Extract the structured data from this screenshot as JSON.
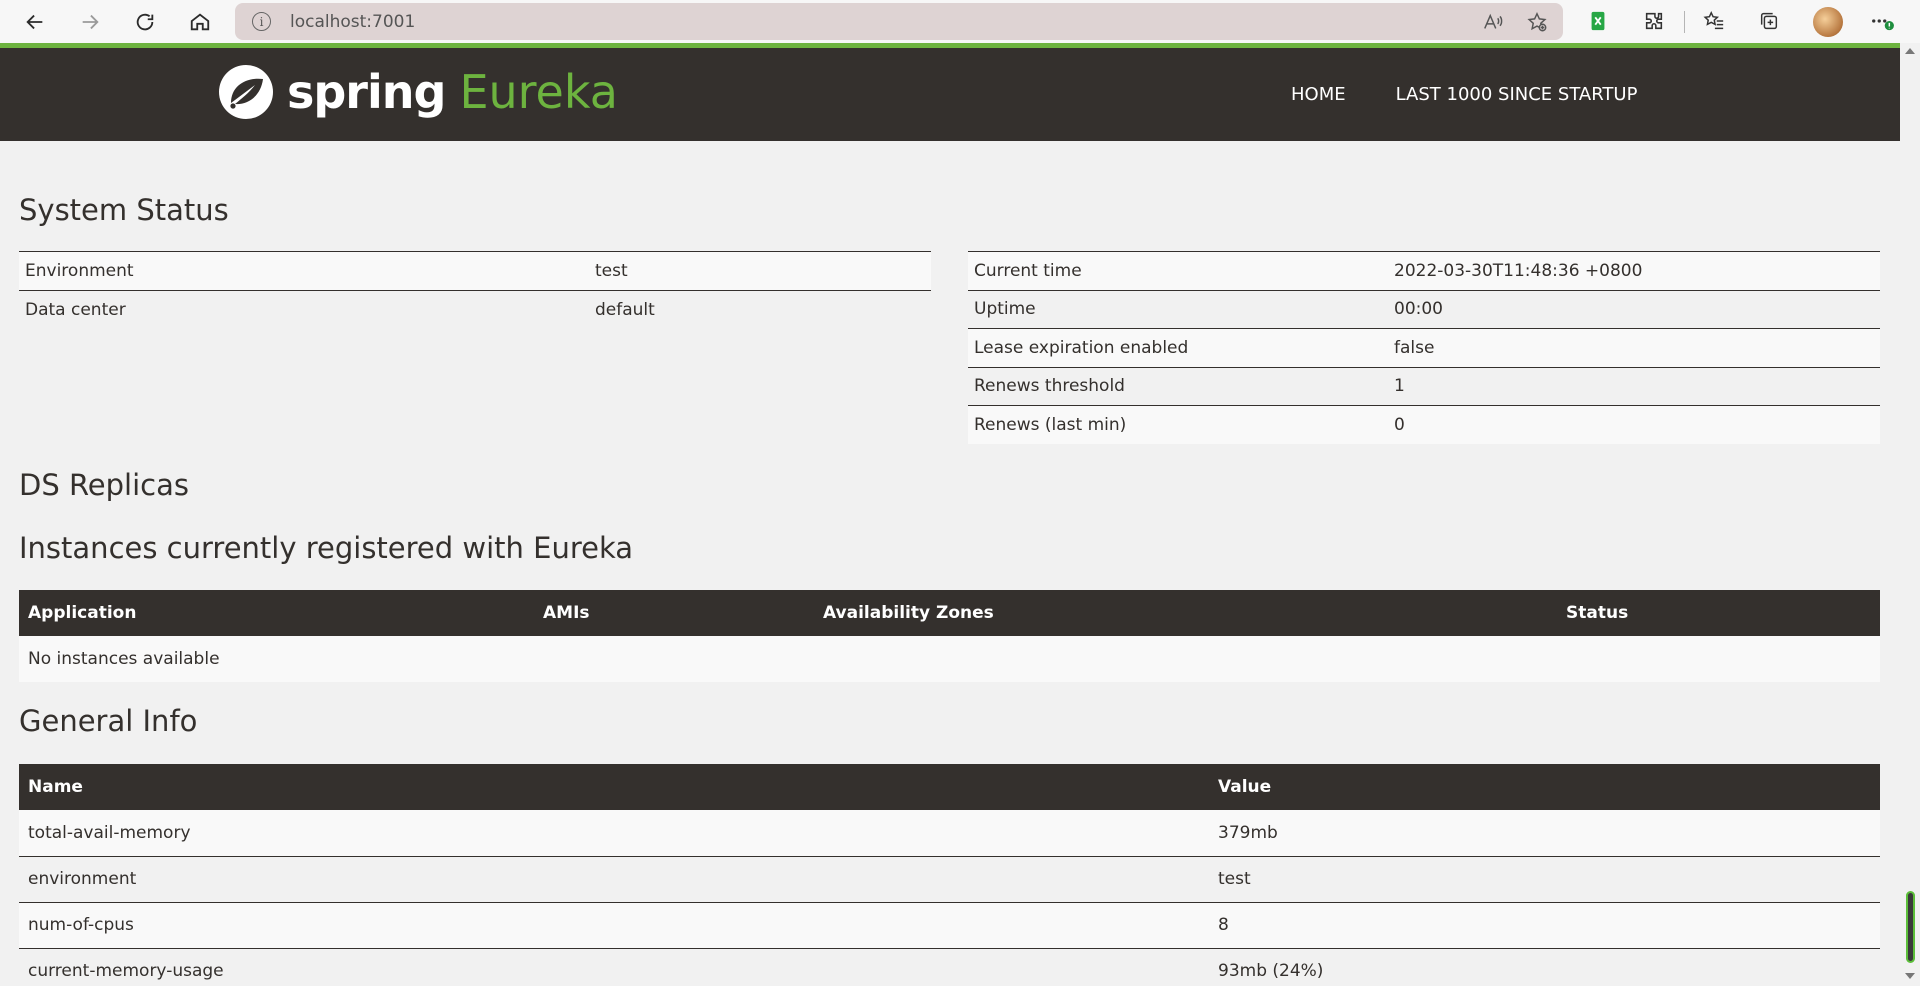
{
  "browser": {
    "url": "localhost:7001",
    "info_glyph": "i",
    "icons": [
      "back-icon",
      "forward-icon",
      "refresh-icon",
      "home-icon",
      "read-aloud-icon",
      "add-favorite-icon",
      "extension-green-icon",
      "extensions-icon",
      "favorites-icon",
      "collections-icon",
      "profile-avatar",
      "more-icon"
    ]
  },
  "header": {
    "brand_spring": "spring",
    "brand_eureka": "Eureka",
    "nav": [
      {
        "label": "HOME"
      },
      {
        "label": "LAST 1000 SINCE STARTUP"
      }
    ],
    "colors": {
      "bar": "#34302d",
      "accent": "#6db33f"
    }
  },
  "system_status": {
    "title": "System Status",
    "left": [
      {
        "label": "Environment",
        "value": "test"
      },
      {
        "label": "Data center",
        "value": "default"
      }
    ],
    "right": [
      {
        "label": "Current time",
        "value": "2022-03-30T11:48:36 +0800"
      },
      {
        "label": "Uptime",
        "value": "00:00"
      },
      {
        "label": "Lease expiration enabled",
        "value": "false"
      },
      {
        "label": "Renews threshold",
        "value": "1"
      },
      {
        "label": "Renews (last min)",
        "value": "0"
      }
    ]
  },
  "ds_replicas": {
    "title": "DS Replicas"
  },
  "instances": {
    "title": "Instances currently registered with Eureka",
    "columns": [
      "Application",
      "AMIs",
      "Availability Zones",
      "Status"
    ],
    "empty_message": "No instances available"
  },
  "general_info": {
    "title": "General Info",
    "columns": [
      "Name",
      "Value"
    ],
    "rows": [
      {
        "name": "total-avail-memory",
        "value": "379mb"
      },
      {
        "name": "environment",
        "value": "test"
      },
      {
        "name": "num-of-cpus",
        "value": "8"
      },
      {
        "name": "current-memory-usage",
        "value": "93mb (24%)"
      }
    ]
  }
}
